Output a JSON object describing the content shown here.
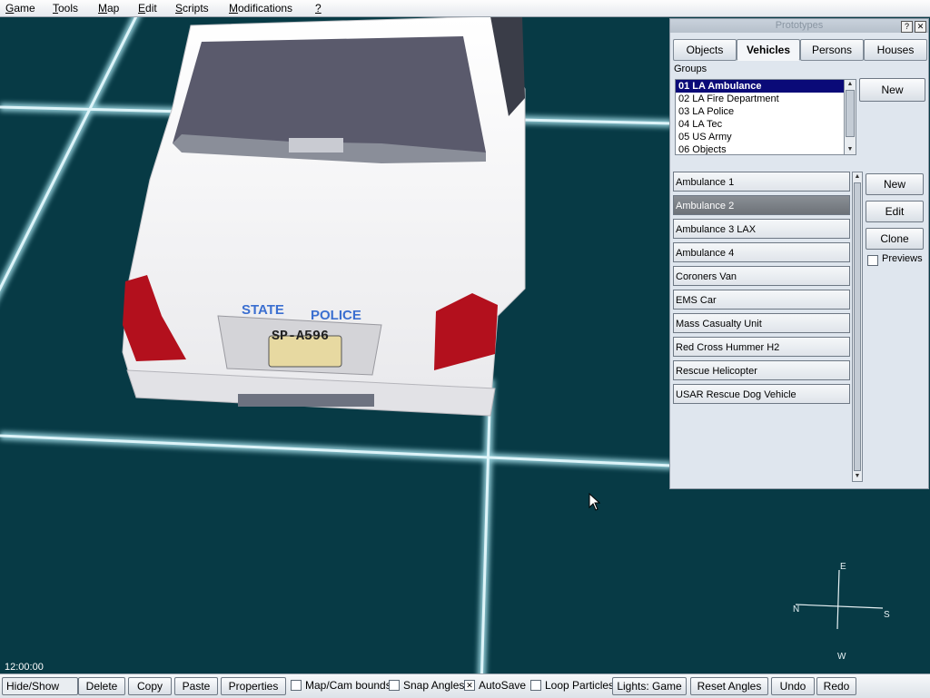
{
  "menubar": {
    "items": [
      {
        "rest": "ame",
        "underline": "G"
      },
      {
        "rest": "ools",
        "underline": "T"
      },
      {
        "rest": "ap",
        "underline": "M"
      },
      {
        "rest": "dit",
        "underline": "E"
      },
      {
        "rest": "cripts",
        "underline": "S"
      },
      {
        "rest": "odifications",
        "underline": "M"
      },
      {
        "rest": "",
        "underline": "?"
      }
    ]
  },
  "panel": {
    "title": "Prototypes",
    "help_btn": "?",
    "close_btn": "✕",
    "tabs": [
      "Objects",
      "Vehicles",
      "Persons",
      "Houses"
    ],
    "active_tab": "Vehicles",
    "groups_label": "Groups",
    "groups": [
      "01 LA Ambulance",
      "02 LA Fire Department",
      "03 LA Police",
      "04 LA Tec",
      "05 US Army",
      "06 Objects"
    ],
    "groups_new": "New",
    "vehicles": [
      "Ambulance 1",
      "Ambulance 2",
      "Ambulance 3 LAX",
      "Ambulance 4",
      "Coroners Van",
      "EMS Car",
      "Mass Casualty Unit",
      "Red Cross Hummer H2",
      "Rescue Helicopter",
      "USAR Rescue Dog Vehicle"
    ],
    "selected_vehicle": "Ambulance 2",
    "buttons": {
      "new": "New",
      "edit": "Edit",
      "clone": "Clone"
    },
    "previews_label": "Previews"
  },
  "viewport": {
    "clock": "12:00:00",
    "car_text": {
      "badge1": "STATE",
      "badge2": "POLICE",
      "plate": "SP-A596"
    },
    "compass": {
      "n": "N",
      "e": "E",
      "s": "S",
      "w": "W"
    }
  },
  "toolbar": {
    "hide_show": "Hide/Show",
    "delete": "Delete",
    "copy": "Copy",
    "paste": "Paste",
    "properties": "Properties",
    "map_cam_bounds": "Map/Cam bounds",
    "snap_angles": "Snap Angles",
    "autosave": "AutoSave",
    "autosave_mark": "✕",
    "loop_particles": "Loop Particles",
    "lights": "Lights: Game",
    "reset_angles": "Reset Angles",
    "undo": "Undo",
    "redo": "Redo"
  }
}
